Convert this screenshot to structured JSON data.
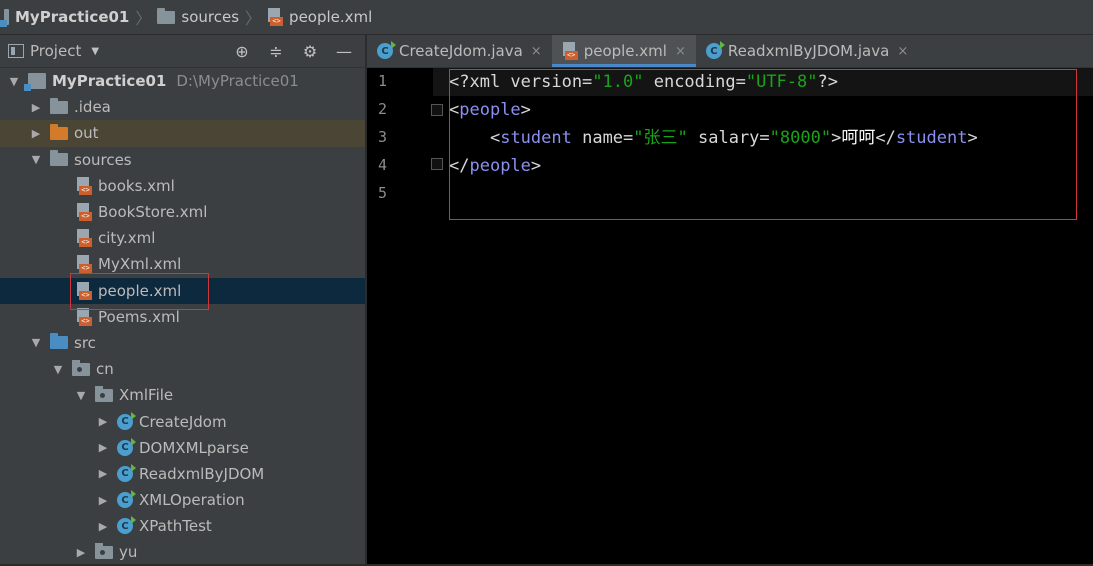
{
  "breadcrumb": {
    "project": "MyPractice01",
    "folder": "sources",
    "file": "people.xml"
  },
  "project_panel": {
    "title": "Project",
    "tools": {
      "locate_icon": "crosshair-icon",
      "collapse_icon": "collapse-icon",
      "settings_icon": "gear-icon",
      "hide_icon": "minus-icon"
    },
    "root": {
      "name": "MyPractice01",
      "path": "D:\\MyPractice01"
    },
    "items": [
      {
        "label": ".idea"
      },
      {
        "label": "out"
      },
      {
        "label": "sources"
      },
      {
        "label": "books.xml"
      },
      {
        "label": "BookStore.xml"
      },
      {
        "label": "city.xml"
      },
      {
        "label": "MyXml.xml"
      },
      {
        "label": "people.xml"
      },
      {
        "label": "Poems.xml"
      },
      {
        "label": "src"
      },
      {
        "label": "cn"
      },
      {
        "label": "XmlFile"
      },
      {
        "label": "CreateJdom"
      },
      {
        "label": "DOMXMLparse"
      },
      {
        "label": "ReadxmlByJDOM"
      },
      {
        "label": "XMLOperation"
      },
      {
        "label": "XPathTest"
      },
      {
        "label": "yu"
      }
    ]
  },
  "tabs": [
    {
      "label": "CreateJdom.java",
      "close": "×"
    },
    {
      "label": "people.xml",
      "close": "×"
    },
    {
      "label": "ReadxmlByJDOM.java",
      "close": "×"
    }
  ],
  "editor": {
    "line_numbers": [
      "1",
      "2",
      "3",
      "4",
      "5"
    ],
    "line1": {
      "a": "<?xml version=",
      "b": "\"1.0\"",
      "c": " encoding=",
      "d": "\"UTF-8\"",
      "e": "?>"
    },
    "line2": {
      "a": "<",
      "b": "people",
      "c": ">"
    },
    "line3": {
      "indent": "    ",
      "a": "<",
      "b": "student",
      "c": " name=",
      "d": "\"张三\"",
      "e": " salary=",
      "f": "\"8000\"",
      "g": ">",
      "h": "呵呵",
      "i": "</",
      "j": "student",
      "k": ">"
    },
    "line4": {
      "a": "</",
      "b": "people",
      "c": ">"
    }
  }
}
